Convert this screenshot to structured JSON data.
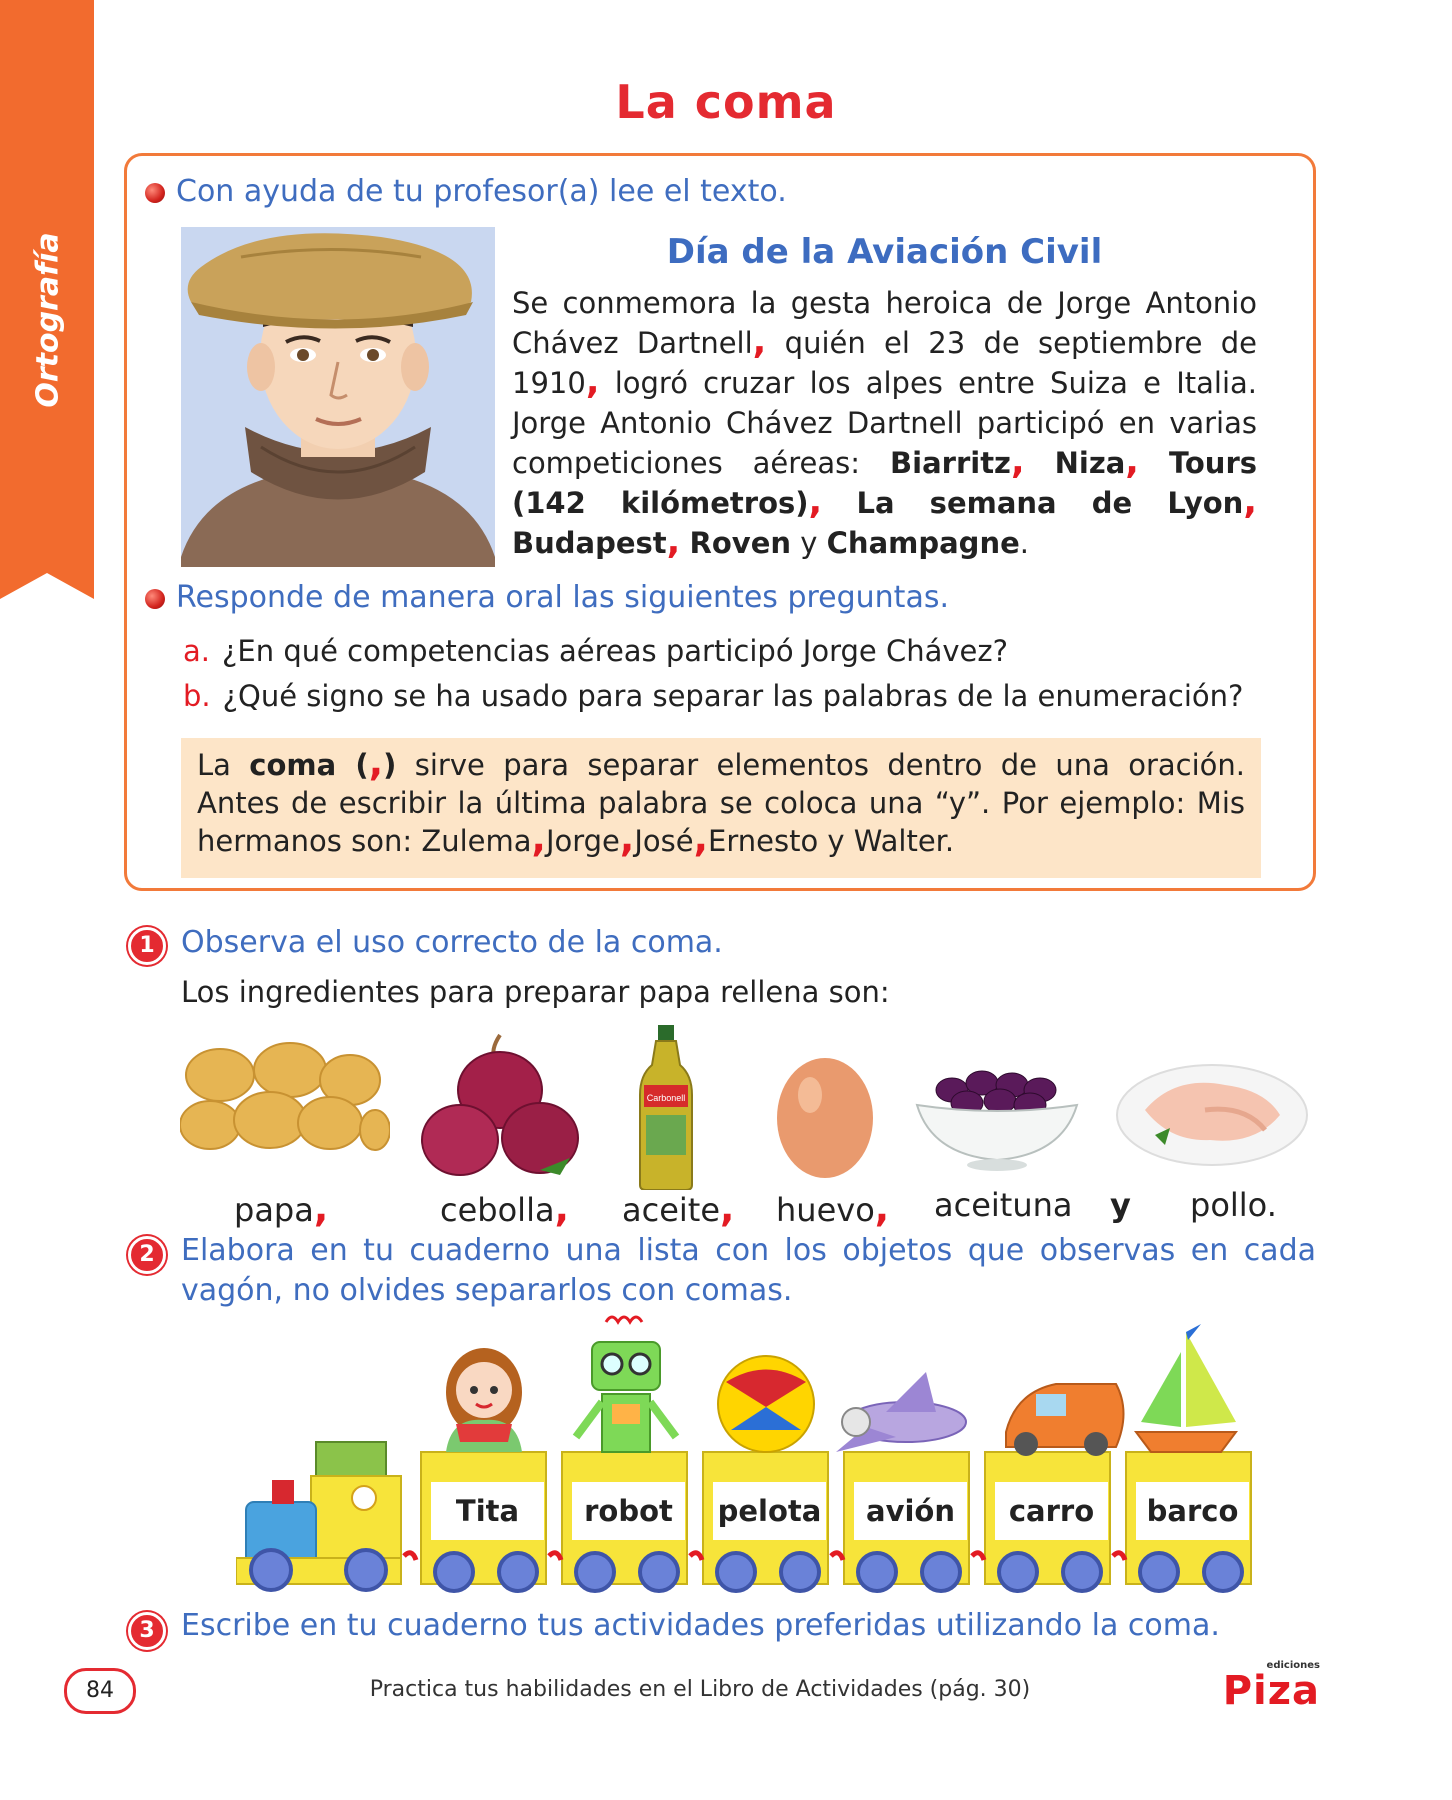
{
  "side_tab": {
    "label": "Ortografía"
  },
  "title": "La coma",
  "reading_section": {
    "instruction": "Con ayuda de tu profesor(a) lee el texto.",
    "reading_title": "Día de la Aviación Civil",
    "p1": "Se conmemora la gesta heroica de Jorge Antonio Chávez Dartnell",
    "p2": " quién el 23 de septiembre de 1910",
    "p3": " logró cruzar los alpes entre Suiza e Italia. Jorge Antonio Chávez Dartnell participó en varias competiciones aéreas: ",
    "items": [
      "Biarritz",
      "Niza",
      "Tours (142 kilómetros)",
      "La semana de Lyon",
      "Budapest",
      "Roven"
    ],
    "connector": "y",
    "last_item": "Champagne",
    "end": ".",
    "comma": ","
  },
  "questions_section": {
    "instruction": "Responde de manera oral las siguientes preguntas.",
    "questions": [
      {
        "letter": "a.",
        "text": "¿En qué competencias aéreas participó Jorge Chávez?"
      },
      {
        "letter": "b.",
        "text": "¿Qué signo se ha usado para separar las palabras de la enumeración?"
      }
    ]
  },
  "rule_box": {
    "t1": "La ",
    "term": "coma (",
    "comma": ",",
    "term_close": ")",
    "t2": " sirve para separar elementos dentro de una oración. Antes de escribir la última palabra se coloca una “y”. Por ejemplo: Mis hermanos son: Zulema",
    "n2": "Jorge",
    "n3": "José",
    "n4": "Ernesto y Walter."
  },
  "activity1": {
    "number": "1",
    "instruction": "Observa el uso correcto de la coma.",
    "intro": "Los ingredientes para preparar papa rellena son:",
    "ingredients": [
      "papa",
      "cebolla",
      "aceite",
      "huevo",
      "aceituna",
      "pollo."
    ],
    "connector": "y",
    "comma": ",",
    "bottle_label": "Carbonell"
  },
  "activity2": {
    "number": "2",
    "instruction": "Elabora en tu cuaderno una lista con los objetos que observas en cada vagón, no olvides separarlos con comas.",
    "wagons": [
      "Tita",
      "robot",
      "pelota",
      "avión",
      "carro",
      "barco"
    ]
  },
  "activity3": {
    "number": "3",
    "instruction": "Escribe en tu cuaderno tus actividades preferidas utilizando la coma."
  },
  "footer": {
    "page_number": "84",
    "note": "Practica tus habilidades en el Libro de Actividades (pág. 30)",
    "publisher_small": "ediciones",
    "publisher": "Piza"
  },
  "colors": {
    "accent_orange": "#f26b2e",
    "title_red": "#e42a31",
    "instruction_blue": "#3f6dbf",
    "rule_bg": "#fde5c8"
  }
}
